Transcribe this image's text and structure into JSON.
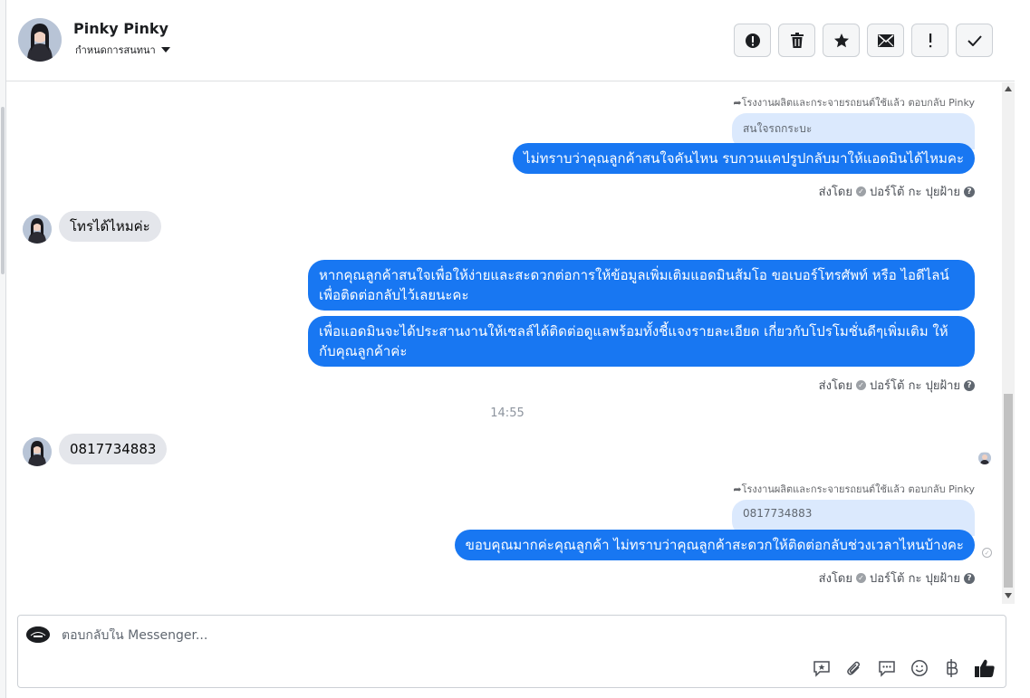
{
  "header": {
    "contact_name": "Pinky Pinky",
    "conversation_label": "กำหนดการสนทนา",
    "actions": [
      "mark-spam",
      "delete",
      "star",
      "mark-unread",
      "follow-up",
      "done"
    ]
  },
  "messages": {
    "reply_note_1": "โรงงานผลิตและกระจายรถยนต์ใช้แล้ว ตอบกลับ Pinky",
    "quote_1": "สนใจรถกระบะ",
    "out_1": "ไม่ทราบว่าคุณลูกค้าสนใจคันไหน รบกวนแคปรูปกลับมาให้แอดมินได้ไหมคะ",
    "sent_by_1": "ส่งโดย",
    "sender_name_1": "ปอร์โต้ กะ ปุยฝ้าย",
    "in_1": "โทรได้ไหมค่ะ",
    "out_2": "หากคุณลูกค้าสนใจเพื่อให้ง่ายและสะดวกต่อการให้ข้อมูลเพิ่มเติมแอดมินส้มโอ ขอเบอร์โทรศัพท์ หรือ ไอดีไลน์ เพื่อติดต่อกลับไว้เลยนะคะ",
    "out_3": "เพื่อแอดมินจะได้ประสานงานให้เซลล์ได้ติดต่อดูแลพร้อมทั้งชี้แจงรายละเอียด เกี่ยวกับโปรโมชั่นดีๆเพิ่มเติม ให้กับคุณลูกค้าค่ะ",
    "sent_by_2": "ส่งโดย",
    "sender_name_2": "ปอร์โต้ กะ ปุยฝ้าย",
    "timestamp": "14:55",
    "in_2": "0817734883",
    "reply_note_2": "โรงงานผลิตและกระจายรถยนต์ใช้แล้ว ตอบกลับ Pinky",
    "quote_2": "0817734883",
    "out_4": "ขอบคุณมากค่ะคุณลูกค้า ไม่ทราบว่าคุณลูกค้าสะดวกให้ติดต่อกลับช่วงเวลาไหนบ้างคะ",
    "sent_by_3": "ส่งโดย",
    "sender_name_3": "ปอร์โต้ กะ ปุยฝ้าย"
  },
  "composer": {
    "placeholder": "ตอบกลับใน Messenger...",
    "tools": [
      "sticker-icon",
      "attachment-icon",
      "saved-replies-icon",
      "emoji-icon",
      "baht-payment-icon",
      "like-icon"
    ]
  },
  "colors": {
    "outgoing_bubble": "#1877f2",
    "incoming_bubble": "#e4e6eb",
    "quote_bubble": "#dbe9fd"
  }
}
